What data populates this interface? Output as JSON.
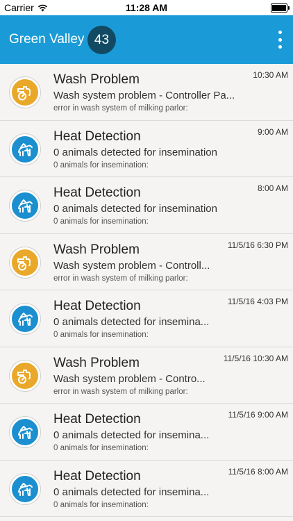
{
  "status_bar": {
    "carrier": "Carrier",
    "time": "11:28 AM"
  },
  "header": {
    "title": "Green Valley",
    "count": "43",
    "accent_color": "#1a9bd7",
    "badge_color": "#124a63"
  },
  "alerts": [
    {
      "type": "wash",
      "icon": "wash-problem-icon",
      "title": "Wash Problem",
      "summary": "Wash system problem - Controller Pa...",
      "detail": "error in wash system of milking parlor:",
      "time": "10:30 AM"
    },
    {
      "type": "heat",
      "icon": "heat-detection-icon",
      "title": "Heat Detection",
      "summary": "0 animals detected for insemination",
      "detail": "0 animals for insemination:",
      "time": "9:00 AM"
    },
    {
      "type": "heat",
      "icon": "heat-detection-icon",
      "title": "Heat Detection",
      "summary": "0 animals detected for insemination",
      "detail": "0 animals for insemination:",
      "time": "8:00 AM"
    },
    {
      "type": "wash",
      "icon": "wash-problem-icon",
      "title": "Wash Problem",
      "summary": "Wash system problem - Controll...",
      "detail": "error in wash system of milking parlor:",
      "time": "11/5/16 6:30 PM"
    },
    {
      "type": "heat",
      "icon": "heat-detection-icon",
      "title": "Heat Detection",
      "summary": "0 animals detected for insemina...",
      "detail": "0 animals for insemination:",
      "time": "11/5/16 4:03 PM"
    },
    {
      "type": "wash",
      "icon": "wash-problem-icon",
      "title": "Wash Problem",
      "summary": "Wash system problem - Contro...",
      "detail": "error in wash system of milking parlor:",
      "time": "11/5/16 10:30 AM"
    },
    {
      "type": "heat",
      "icon": "heat-detection-icon",
      "title": "Heat Detection",
      "summary": "0 animals detected for insemina...",
      "detail": "0 animals for insemination:",
      "time": "11/5/16 9:00 AM"
    },
    {
      "type": "heat",
      "icon": "heat-detection-icon",
      "title": "Heat Detection",
      "summary": "0 animals detected for insemina...",
      "detail": "0 animals for insemination:",
      "time": "11/5/16 8:00 AM"
    }
  ],
  "colors": {
    "wash": "#e9a82a",
    "heat": "#1b8fcf"
  }
}
